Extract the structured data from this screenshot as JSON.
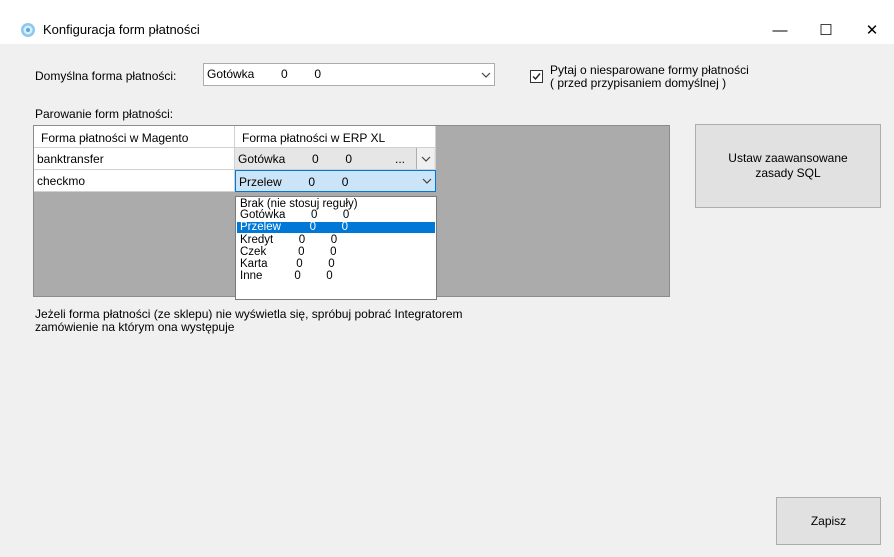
{
  "window": {
    "title": "Konfiguracja form płatności"
  },
  "default_payment": {
    "label": "Domyślna forma płatności:",
    "value": "Gotówka        0        0"
  },
  "ask_checkbox": {
    "checked": true,
    "line1": "Pytaj o niesparowane formy płatności",
    "line2": "( przed przypisaniem domyślnej )"
  },
  "pairing": {
    "label": "Parowanie form płatności:",
    "columns": [
      "Forma płatności w Magento",
      "Forma płatności w ERP XL"
    ],
    "rows": [
      {
        "magento": "banktransfer",
        "erp": "Gotówka        0        0",
        "ellipsis": "..."
      },
      {
        "magento": "checkmo",
        "erp": "Przelew        0        0"
      }
    ]
  },
  "dropdown": {
    "options": [
      "Brak (nie stosuj reguły)",
      "Gotówka        0        0",
      "Przelew         0        0",
      "Kredyt        0        0",
      "Czek          0        0",
      "Karta         0        0",
      "Inne          0        0"
    ],
    "selected_index": 2
  },
  "info": {
    "line1": "Jeżeli forma płatności (ze sklepu) nie wyświetla się, spróbuj pobrać Integratorem",
    "line2": "zamówienie na którym ona występuje"
  },
  "buttons": {
    "advanced_sql": "Ustaw zaawansowane zasady SQL",
    "save": "Zapisz"
  },
  "window_controls": {
    "minimize": "—",
    "maximize": "☐",
    "close": "✕"
  }
}
